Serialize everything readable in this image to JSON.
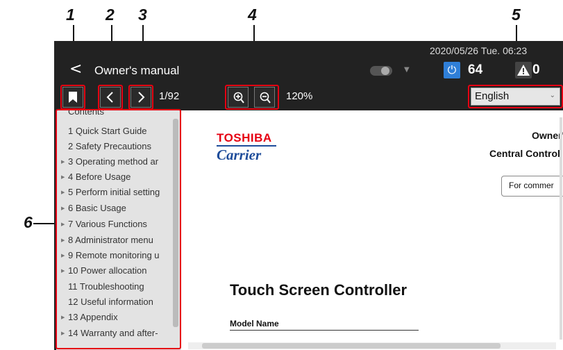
{
  "callouts": [
    "1",
    "2",
    "3",
    "4",
    "5",
    "6"
  ],
  "header": {
    "datetime": "2020/05/26 Tue. 06:23",
    "back_symbol": "<",
    "title": "Owner's manual",
    "power_count": "64",
    "alarm_count": "0",
    "power_icon": "power-icon",
    "alarm_icon": "warning-icon"
  },
  "toolbar": {
    "page_indicator": "1/92",
    "zoom_level": "120%",
    "language": "English",
    "bookmark_icon": "bookmark-icon",
    "prev_icon": "chevron-left-icon",
    "next_icon": "chevron-right-icon",
    "zoom_in_icon": "zoom-in-icon",
    "zoom_out_icon": "zoom-out-icon"
  },
  "sidebar": {
    "items": [
      {
        "label": "Contents",
        "expandable": false
      },
      {
        "label": "1 Quick Start Guide",
        "expandable": false
      },
      {
        "label": "2 Safety Precautions",
        "expandable": false
      },
      {
        "label": "3 Operating method ar",
        "expandable": true
      },
      {
        "label": "4 Before Usage",
        "expandable": true
      },
      {
        "label": "5 Perform initial setting",
        "expandable": true
      },
      {
        "label": "6 Basic Usage",
        "expandable": true
      },
      {
        "label": "7 Various Functions",
        "expandable": true
      },
      {
        "label": "8 Administrator menu",
        "expandable": true
      },
      {
        "label": "9 Remote monitoring u",
        "expandable": true
      },
      {
        "label": "10 Power allocation",
        "expandable": true
      },
      {
        "label": "11 Troubleshooting",
        "expandable": false
      },
      {
        "label": "12 Useful information",
        "expandable": false
      },
      {
        "label": "13 Appendix",
        "expandable": true
      },
      {
        "label": "14 Warranty and after-",
        "expandable": true
      }
    ]
  },
  "document": {
    "brand_top": "TOSHIBA",
    "brand_bottom": "Carrier",
    "owner_text": "Owner's",
    "central_text": "Central Control",
    "commercial_text": "For commer",
    "heading": "Touch Screen Controller",
    "model_label": "Model Name"
  },
  "colors": {
    "highlight": "#e60012",
    "power_accent": "#2f7fd8",
    "toshiba_red": "#e60012",
    "carrier_blue": "#1e4c9a"
  }
}
